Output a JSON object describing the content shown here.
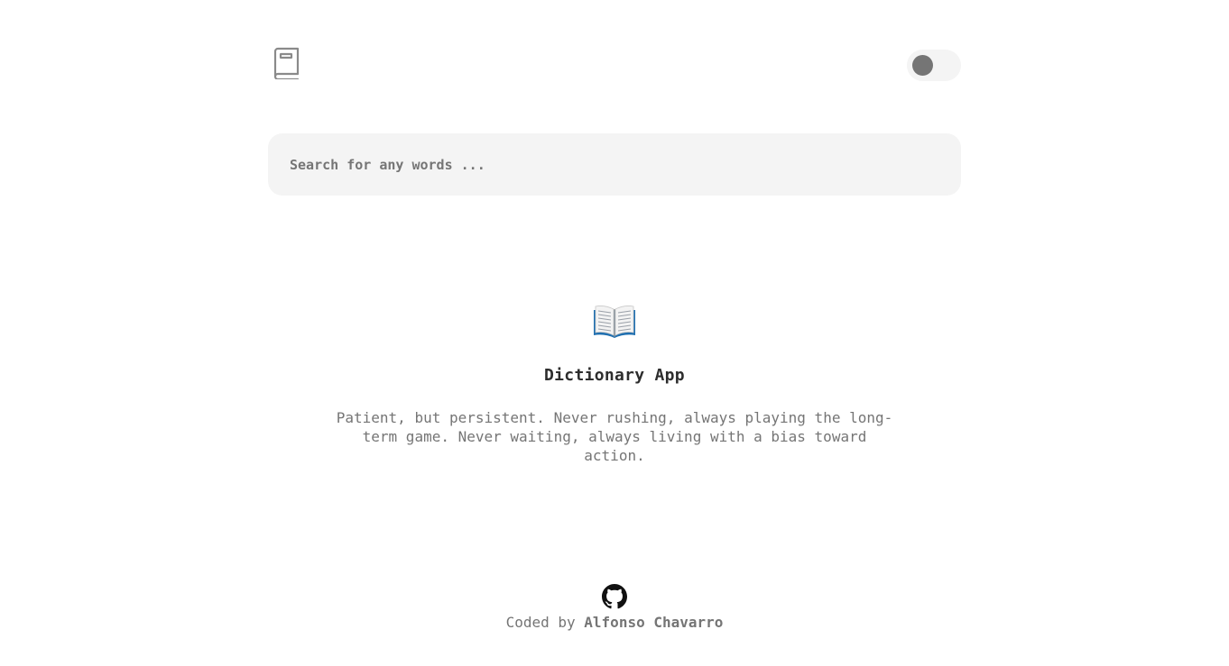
{
  "header": {
    "logo_icon": "book-icon",
    "theme_toggle": {
      "state": "off",
      "icon": "toggle-knob"
    }
  },
  "search": {
    "placeholder": "Search for any words ...",
    "value": ""
  },
  "hero": {
    "icon": "open-book-emoji",
    "title": "Dictionary App",
    "text": "Patient, but persistent. Never rushing, always playing the long-term game. Never waiting, always living with a bias toward action."
  },
  "footer": {
    "icon": "github-icon",
    "prefix": "Coded by",
    "author": "Alfonso Chavarro"
  },
  "colors": {
    "background": "#ffffff",
    "surface": "#f4f4f4",
    "muted_text": "#757575",
    "title_text": "#2d2d2d"
  }
}
